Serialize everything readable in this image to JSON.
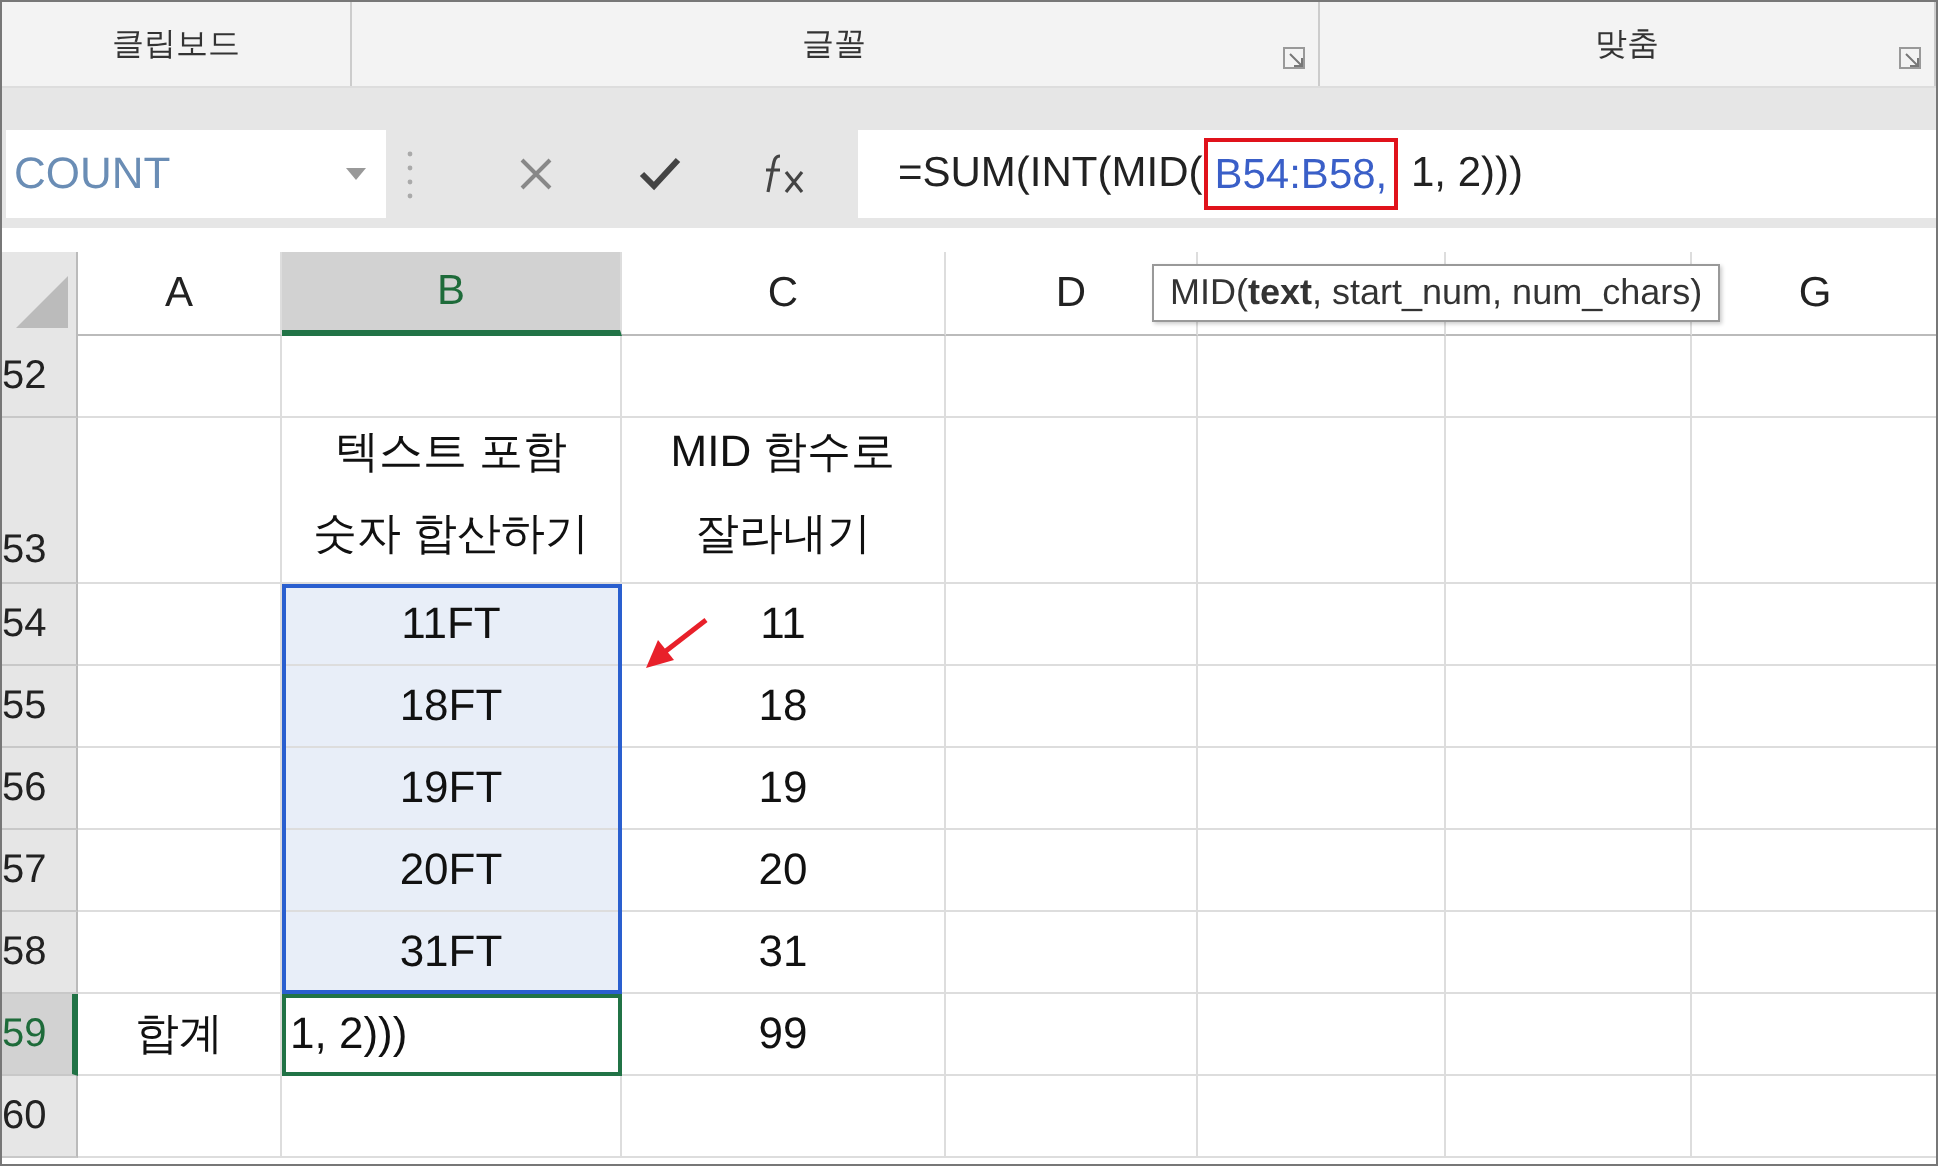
{
  "ribbon_groups": [
    {
      "label": "클립보드",
      "launcher": false
    },
    {
      "label": "글꼴",
      "launcher": true
    },
    {
      "label": "맞춤",
      "launcher": true
    }
  ],
  "name_box": {
    "value": "COUNT"
  },
  "formula_bar": {
    "parts": [
      {
        "text": "=SUM(INT(MID(",
        "kind": "plain",
        "highlighted": false
      },
      {
        "text": "B54:B58,",
        "kind": "reference",
        "highlighted": true
      },
      {
        "text": " 1, 2)))",
        "kind": "plain",
        "highlighted": false
      }
    ]
  },
  "tooltip": "MID(**text**, start_num, num_chars)",
  "columns": [
    {
      "label": "A",
      "selected": false
    },
    {
      "label": "B",
      "selected": true
    },
    {
      "label": "C",
      "selected": false
    },
    {
      "label": "D",
      "selected": false
    },
    {
      "selected": false
    },
    {
      "selected": false
    },
    {
      "label": "G",
      "selected": false
    }
  ],
  "rows": [
    {
      "header": "52",
      "selected": false,
      "tall": false,
      "cells": [
        {},
        {},
        {}
      ]
    },
    {
      "header": "53",
      "selected": false,
      "tall": true,
      "cells": [
        {},
        {
          "lines": [
            "텍스트 포함",
            "숫자 합산하기"
          ]
        },
        {
          "lines": [
            "MID 함수로",
            "잘라내기"
          ]
        }
      ]
    },
    {
      "header": "54",
      "selected": false,
      "tall": false,
      "cells": [
        {},
        {
          "text": "11FT",
          "in_range": true
        },
        {
          "text": "11"
        }
      ]
    },
    {
      "header": "55",
      "selected": false,
      "tall": false,
      "cells": [
        {},
        {
          "text": "18FT",
          "in_range": true
        },
        {
          "text": "18"
        }
      ]
    },
    {
      "header": "56",
      "selected": false,
      "tall": false,
      "cells": [
        {},
        {
          "text": "19FT",
          "in_range": true
        },
        {
          "text": "19"
        }
      ]
    },
    {
      "header": "57",
      "selected": false,
      "tall": false,
      "cells": [
        {},
        {
          "text": "20FT",
          "in_range": true
        },
        {
          "text": "20"
        }
      ]
    },
    {
      "header": "58",
      "selected": false,
      "tall": false,
      "cells": [
        {},
        {
          "text": "31FT",
          "in_range": true
        },
        {
          "text": "31"
        }
      ]
    },
    {
      "header": "59",
      "selected": true,
      "tall": false,
      "cells": [
        {
          "text": "합계"
        },
        {
          "text": "1, 2)))",
          "active": true
        },
        {
          "text": "99"
        }
      ]
    },
    {
      "header": "60",
      "selected": false,
      "tall": false,
      "cells": [
        {},
        {},
        {}
      ]
    }
  ]
}
